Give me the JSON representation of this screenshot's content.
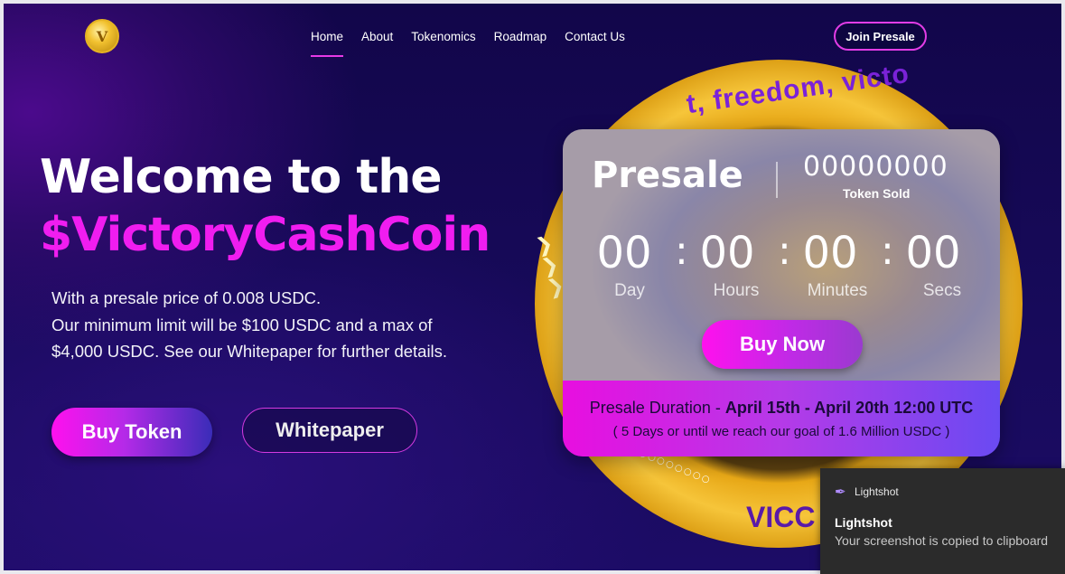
{
  "nav": {
    "items": [
      {
        "label": "Home",
        "active": true
      },
      {
        "label": "About"
      },
      {
        "label": "Tokenomics"
      },
      {
        "label": "Roadmap"
      },
      {
        "label": "Contact Us"
      }
    ],
    "join_label": "Join Presale"
  },
  "hero": {
    "title_line1": "Welcome to the",
    "title_line2": "$VictoryCashCoin",
    "desc_line1": "With a presale price of 0.008 USDC.",
    "desc_line2": "Our minimum limit will be $100 USDC and a max of",
    "desc_line3": "$4,000 USDC. See our Whitepaper for further details.",
    "buy_label": "Buy Token",
    "whitepaper_label": "Whitepaper"
  },
  "coin": {
    "ring_text": "t, freedom, victo",
    "bottom_text": "VICC"
  },
  "presale": {
    "title": "Presale",
    "sold_count": "00000000",
    "sold_label": "Token Sold",
    "timer": [
      {
        "value": "00",
        "label": "Day"
      },
      {
        "value": "00",
        "label": "Hours"
      },
      {
        "value": "00",
        "label": "Minutes"
      },
      {
        "value": "00",
        "label": "Secs"
      }
    ],
    "buy_now_label": "Buy Now",
    "duration_prefix": "Presale Duration - ",
    "duration_dates": "April 15th - April 20th 12:00 UTC",
    "duration_note": "( 5 Days or until we reach our goal of 1.6 Million USDC )"
  },
  "toast": {
    "app": "Lightshot",
    "title": "Lightshot",
    "message": "Your screenshot is copied to clipboard"
  },
  "colors": {
    "accent": "#f01df0",
    "background": "#150856"
  }
}
